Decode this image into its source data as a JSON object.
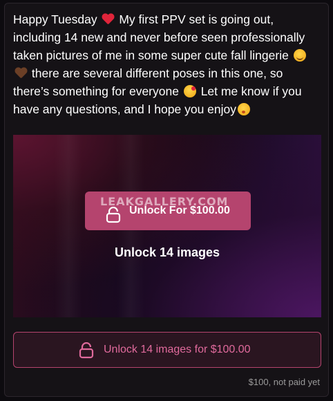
{
  "post": {
    "text_1": "Happy Tuesday",
    "text_2": "My first PPV set is going out, including 14 new and never before seen professionally taken pictures of me in some super cute fall lingerie",
    "text_3": "there are several different poses in this one, so there’s something for everyone",
    "text_4": "Let me know if you have any questions, and I hope you enjoy",
    "emojis": [
      "red-heart",
      "smirking-face",
      "brown-heart",
      "face-blowing-kiss",
      "kissing-face-with-closed-eyes"
    ]
  },
  "media": {
    "watermark": "LEAKGALLERY.COM",
    "unlock_label": "Unlock For $100.00",
    "caption": "Unlock 14 images"
  },
  "unlock_button": {
    "label": "Unlock 14 images for $100.00"
  },
  "status": "$100, not paid yet",
  "colors": {
    "accent": "#b5446e",
    "accent_text": "#e06a9c",
    "card_bg": "#151216"
  }
}
